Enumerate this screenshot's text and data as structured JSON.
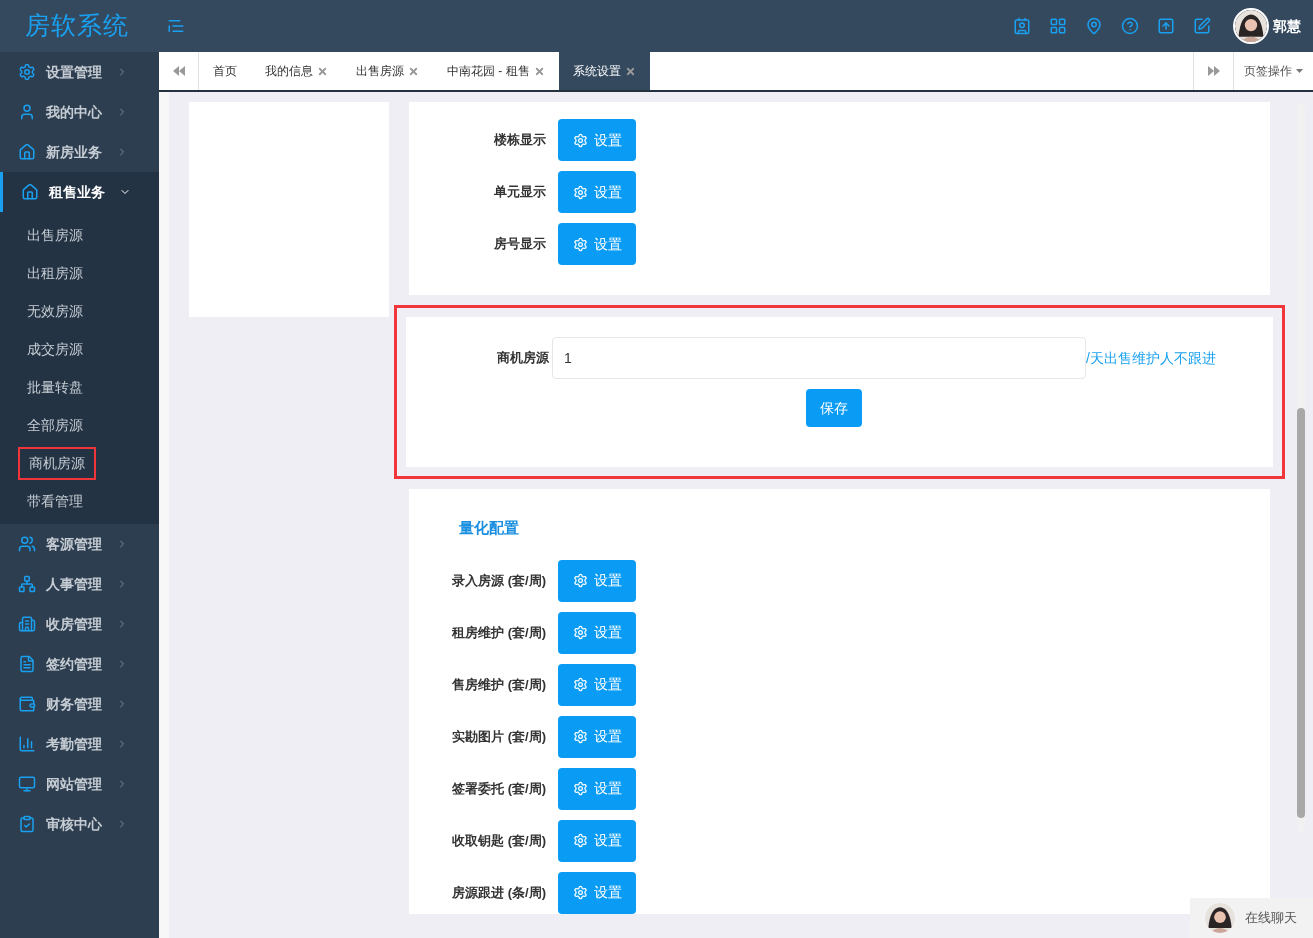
{
  "header": {
    "logo": "房软系统",
    "user_name": "郭慧"
  },
  "sidebar": {
    "items": [
      {
        "label": "设置管理",
        "expanded": false
      },
      {
        "label": "我的中心",
        "expanded": false
      },
      {
        "label": "新房业务",
        "expanded": false
      },
      {
        "label": "租售业务",
        "expanded": true,
        "children": [
          {
            "label": "出售房源",
            "highlighted": false
          },
          {
            "label": "出租房源",
            "highlighted": false
          },
          {
            "label": "无效房源",
            "highlighted": false
          },
          {
            "label": "成交房源",
            "highlighted": false
          },
          {
            "label": "批量转盘",
            "highlighted": false
          },
          {
            "label": "全部房源",
            "highlighted": false
          },
          {
            "label": "商机房源",
            "highlighted": true
          },
          {
            "label": "带看管理",
            "highlighted": false
          }
        ]
      },
      {
        "label": "客源管理",
        "expanded": false
      },
      {
        "label": "人事管理",
        "expanded": false
      },
      {
        "label": "收房管理",
        "expanded": false
      },
      {
        "label": "签约管理",
        "expanded": false
      },
      {
        "label": "财务管理",
        "expanded": false
      },
      {
        "label": "考勤管理",
        "expanded": false
      },
      {
        "label": "网站管理",
        "expanded": false
      },
      {
        "label": "审核中心",
        "expanded": false
      }
    ]
  },
  "tabs": [
    {
      "label": "首页",
      "closable": false,
      "selected": false
    },
    {
      "label": "我的信息",
      "closable": true,
      "selected": false
    },
    {
      "label": "出售房源",
      "closable": true,
      "selected": false
    },
    {
      "label": "中南花园 - 租售",
      "closable": true,
      "selected": false
    },
    {
      "label": "系统设置",
      "closable": true,
      "selected": true
    }
  ],
  "tab_actions": "页签操作",
  "display_settings": [
    {
      "label": "楼栋显示",
      "button": "设置"
    },
    {
      "label": "单元显示",
      "button": "设置"
    },
    {
      "label": "房号显示",
      "button": "设置"
    }
  ],
  "opportunity_section": {
    "highlighted": true,
    "label": "商机房源",
    "value": "1",
    "suffix": "/天出售维护人不跟进",
    "save_button": "保存"
  },
  "quantification": {
    "title": "量化配置",
    "rows": [
      {
        "label": "录入房源 (套/周)",
        "button": "设置"
      },
      {
        "label": "租房维护 (套/周)",
        "button": "设置"
      },
      {
        "label": "售房维护 (套/周)",
        "button": "设置"
      },
      {
        "label": "实勘图片 (套/周)",
        "button": "设置"
      },
      {
        "label": "签署委托 (套/周)",
        "button": "设置"
      },
      {
        "label": "收取钥匙 (套/周)",
        "button": "设置"
      },
      {
        "label": "房源跟进 (条/周)",
        "button": "设置"
      }
    ]
  },
  "chat_widget": {
    "label": "在线聊天"
  }
}
